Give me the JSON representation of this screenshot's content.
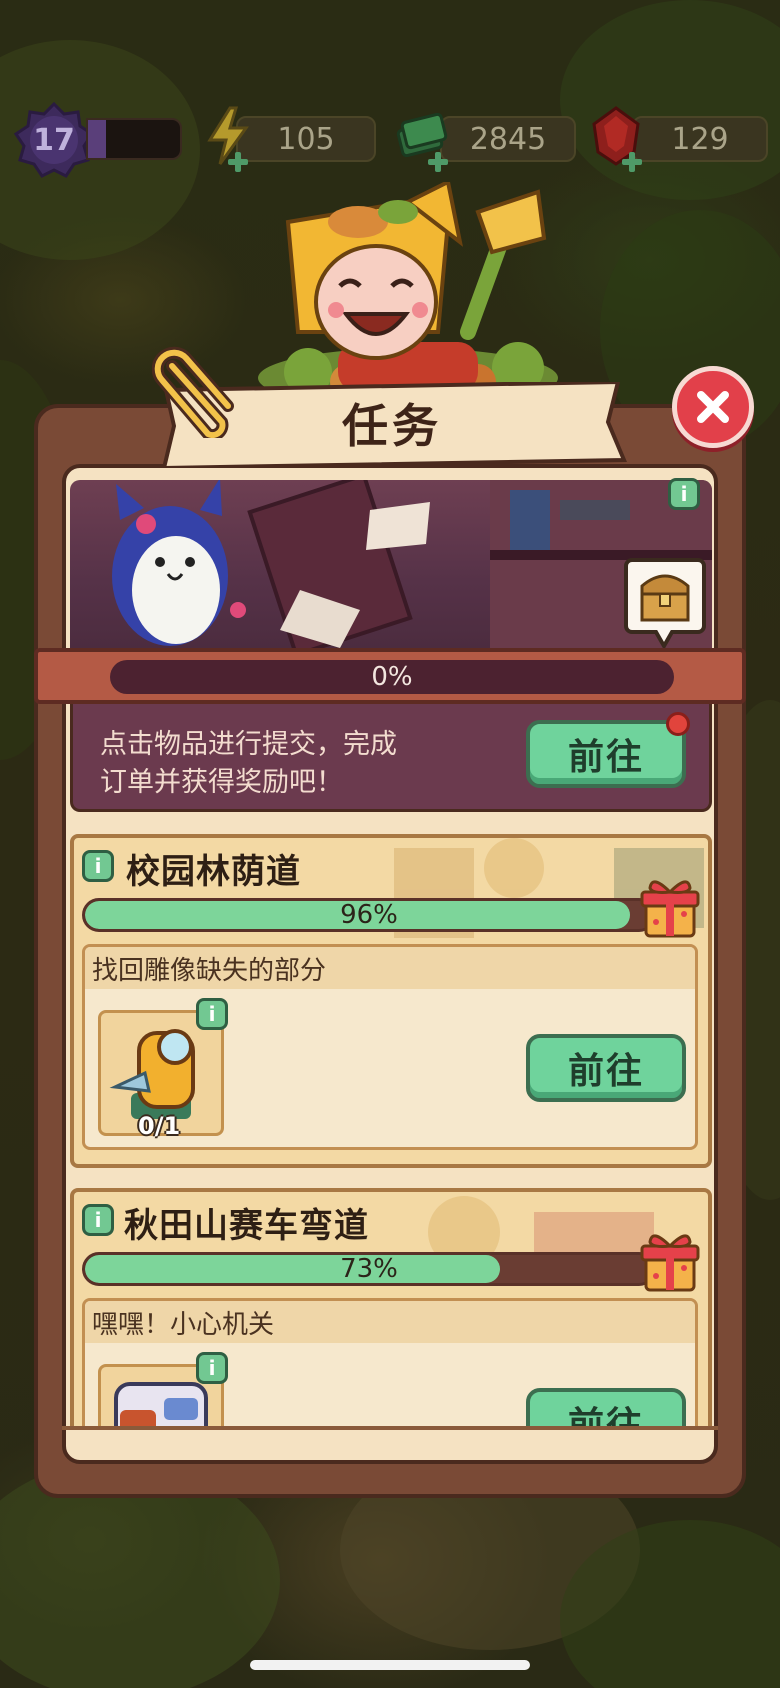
{
  "hud": {
    "level": "17",
    "level_progress": 0.2,
    "energy": "105",
    "cash": "2845",
    "gems": "129",
    "level_icon": "purple-flower-badge",
    "energy_icon": "lightning-icon",
    "cash_icon": "cash-stack-icon",
    "gem_icon": "ruby-gem-icon"
  },
  "dialog": {
    "title": "任务",
    "close_icon": "close-icon"
  },
  "banner": {
    "progress_label": "0%",
    "progress": 0,
    "chest_icon": "treasure-chest-icon",
    "submit_text_line1": "点击物品进行提交，完成",
    "submit_text_line2": "订单并获得奖励吧！",
    "go_label": "前往"
  },
  "quests": [
    {
      "title": "校园林荫道",
      "progress_label": "96%",
      "progress": 0.96,
      "task": "找回雕像缺失的部分",
      "item_count": "0/1",
      "go_label": "前往"
    },
    {
      "title": "秋田山赛车弯道",
      "progress_label": "73%",
      "progress": 0.73,
      "task": "嘿嘿！小心机关",
      "go_label": "前往"
    }
  ],
  "colors": {
    "progress_green": "#7dd59a",
    "button_green": "#6fd39c",
    "close_red": "#e2404a",
    "panel_brown": "#7a4a36"
  }
}
